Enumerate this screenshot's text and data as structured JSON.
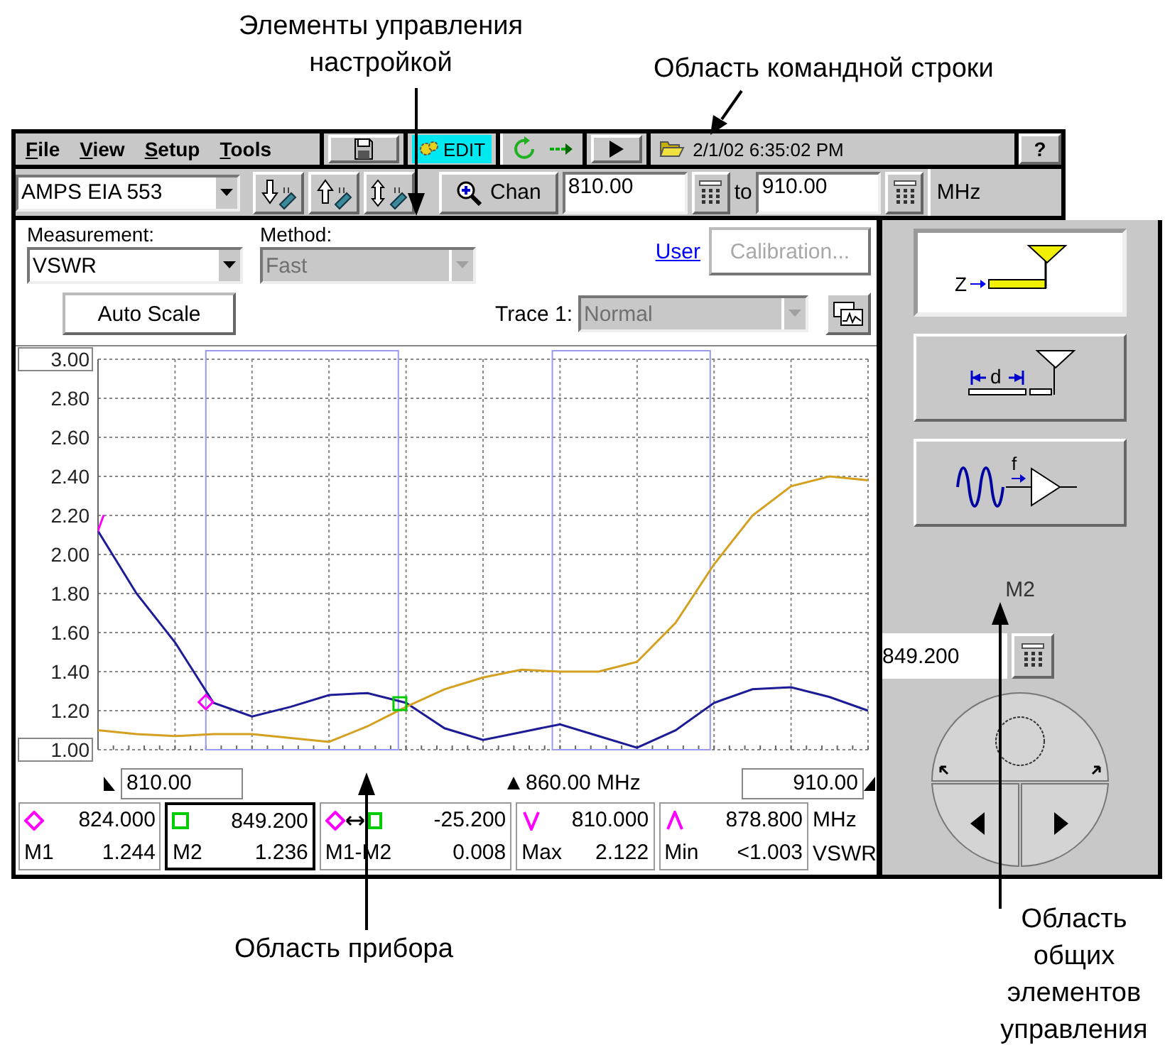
{
  "callouts": {
    "controls": "Элементы управления настройкой",
    "command_line": "Область командной строки",
    "instrument": "Область прибора",
    "common_controls": "Область общих элементов управления"
  },
  "menu": [
    "File",
    "View",
    "Setup",
    "Tools"
  ],
  "toolbar": [
    {
      "kind": "save"
    },
    {
      "kind": "edit",
      "label": "EDIT",
      "on": true
    },
    {
      "kind": "cycle"
    },
    {
      "kind": "play"
    }
  ],
  "status": {
    "text": "2/1/02 6:35:02 PM"
  },
  "help": {
    "label": "?"
  },
  "standard": {
    "value": "AMPS EIA 553"
  },
  "step_buttons": [
    {
      "kind": "down"
    },
    {
      "kind": "up"
    },
    {
      "kind": "updown"
    }
  ],
  "chan_button": {
    "label": "Chan"
  },
  "range": {
    "start": "810.00",
    "to": "to",
    "stop": "910.00",
    "unit": "MHz"
  },
  "measurement": {
    "label": "Measurement:",
    "value": "VSWR",
    "disabled": false
  },
  "method": {
    "label": "Method:",
    "value": "Fast",
    "disabled": true
  },
  "user_link": {
    "label": "User"
  },
  "calibration": {
    "label": "Calibration...",
    "disabled": true
  },
  "auto_scale": {
    "label": "Auto Scale"
  },
  "trace": {
    "label": "Trace 1:",
    "value": "Normal",
    "disabled": true
  },
  "chart": {
    "chart_data": {
      "type": "line",
      "categories": [
        null,
        null,
        null,
        null,
        null,
        null,
        null,
        null,
        null,
        null,
        null,
        null,
        null,
        null,
        null,
        null,
        null,
        null,
        null,
        null,
        null
      ],
      "ylim": [
        1,
        3
      ],
      "grid": true,
      "yticks": [
        {
          "value": 3,
          "label": "3.00"
        },
        {
          "value": 2.8,
          "label": "2.80"
        },
        {
          "value": 2.6,
          "label": "2.60"
        },
        {
          "value": 2.4,
          "label": "2.40"
        },
        {
          "value": 2.2,
          "label": "2.20"
        },
        {
          "value": 2,
          "label": "2.00"
        },
        {
          "value": 1.8,
          "label": "1.80"
        },
        {
          "value": 1.6,
          "label": "1.60"
        },
        {
          "value": 1.4,
          "label": "1.40"
        },
        {
          "value": 1.2,
          "label": "1.20"
        },
        {
          "value": 1,
          "label": "1.00"
        }
      ],
      "series": [
        {
          "color": "#1c1c96",
          "values": [
            2.12,
            1.8,
            1.55,
            1.24,
            1.17,
            1.22,
            1.28,
            1.29,
            1.24,
            1.11,
            1.05,
            1.09,
            1.13,
            1.07,
            1.01,
            1.1,
            1.24,
            1.31,
            1.32,
            1.27,
            1.2
          ]
        },
        {
          "color": "#d4a020",
          "values": [
            1.1,
            1.08,
            1.07,
            1.08,
            1.08,
            1.06,
            1.04,
            1.12,
            1.22,
            1.31,
            1.37,
            1.41,
            1.4,
            1.4,
            1.45,
            1.65,
            1.95,
            2.2,
            2.35,
            2.4,
            2.38
          ]
        }
      ]
    }
  },
  "freq_axis": {
    "start": "810.00",
    "center": "860.00 MHz",
    "stop": "910.00"
  },
  "markers": [
    {
      "kind": "diamond",
      "frequency": "824.000",
      "name": "M1",
      "reading": "1.244",
      "selected": false
    },
    {
      "kind": "square",
      "frequency": "849.200",
      "name": "M2",
      "reading": "1.236",
      "selected": true
    },
    {
      "kind": "delta",
      "frequency": "-25.200",
      "name": "M1-M2",
      "reading": "0.008",
      "selected": false
    },
    {
      "kind": "max",
      "frequency": "810.000",
      "name": "Max",
      "reading": "2.122",
      "selected": false
    },
    {
      "kind": "min",
      "frequency": "878.800",
      "name": "Min",
      "reading": "<1.003",
      "selected": false
    }
  ],
  "units": [
    "MHz",
    "VSWR"
  ],
  "modes": [
    {
      "kind": "impedance",
      "symbol": "Z",
      "selected": true
    },
    {
      "kind": "distance",
      "symbol": "d",
      "selected": false
    },
    {
      "kind": "frequency",
      "symbol": "f",
      "selected": false
    }
  ],
  "active_marker": {
    "label": "M2",
    "value": "849.200"
  }
}
